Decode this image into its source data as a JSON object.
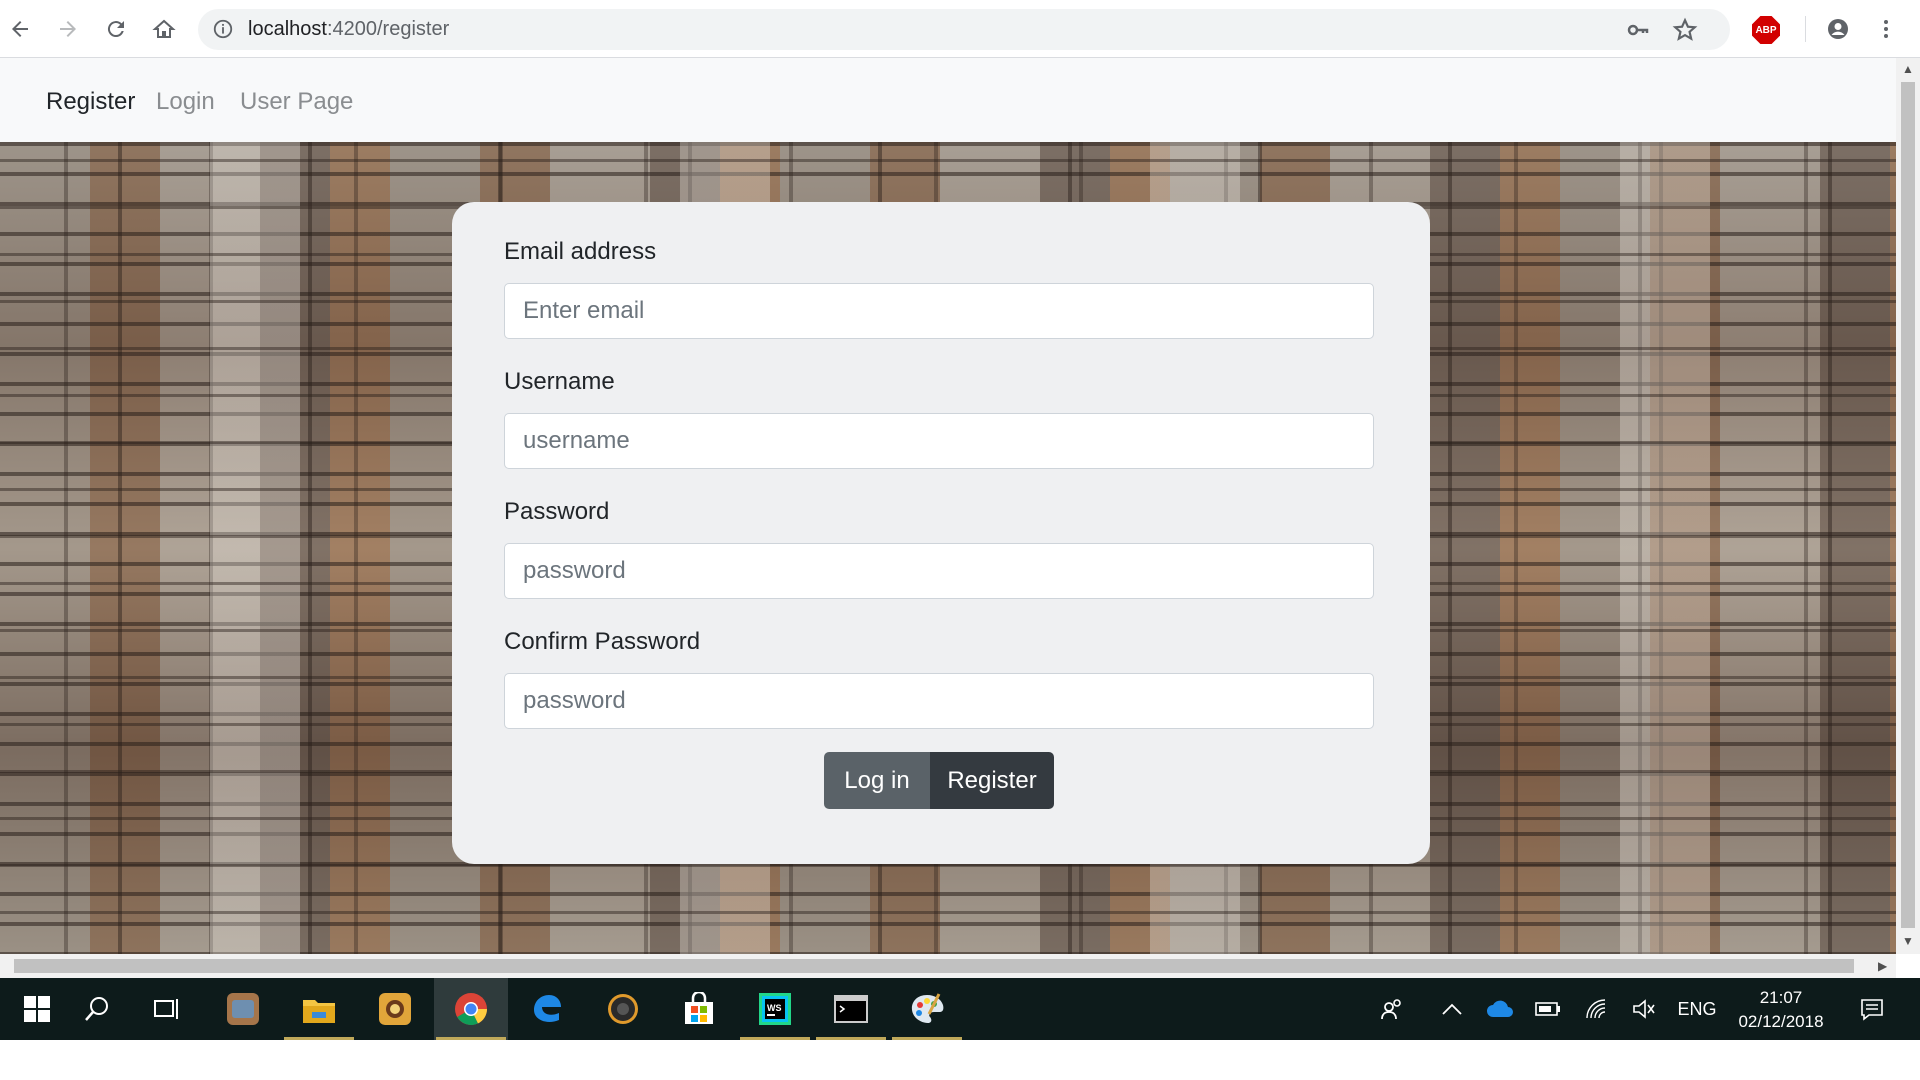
{
  "browser": {
    "url_host": "localhost",
    "url_path": ":4200/register",
    "abp_label": "ABP"
  },
  "navbar": {
    "links": [
      {
        "label": "Register",
        "active": true
      },
      {
        "label": "Login",
        "active": false
      },
      {
        "label": "User Page",
        "active": false
      }
    ]
  },
  "form": {
    "email_label": "Email address",
    "email_placeholder": "Enter email",
    "username_label": "Username",
    "username_placeholder": "username",
    "password_label": "Password",
    "password_placeholder": "password",
    "confirm_label": "Confirm Password",
    "confirm_placeholder": "password",
    "login_button": "Log in",
    "register_button": "Register"
  },
  "taskbar": {
    "apps": [
      "start",
      "search",
      "task-view",
      "app-launcher",
      "file-explorer",
      "app-2",
      "chrome",
      "edge",
      "media",
      "store",
      "webstorm",
      "terminal",
      "paint"
    ],
    "language": "ENG",
    "time": "21:07",
    "date": "02/12/2018"
  },
  "colors": {
    "card_bg": "#eff0f2",
    "login_button": "#5a6268",
    "register_button": "#343a40",
    "navbar_bg": "#f8f9fa"
  }
}
